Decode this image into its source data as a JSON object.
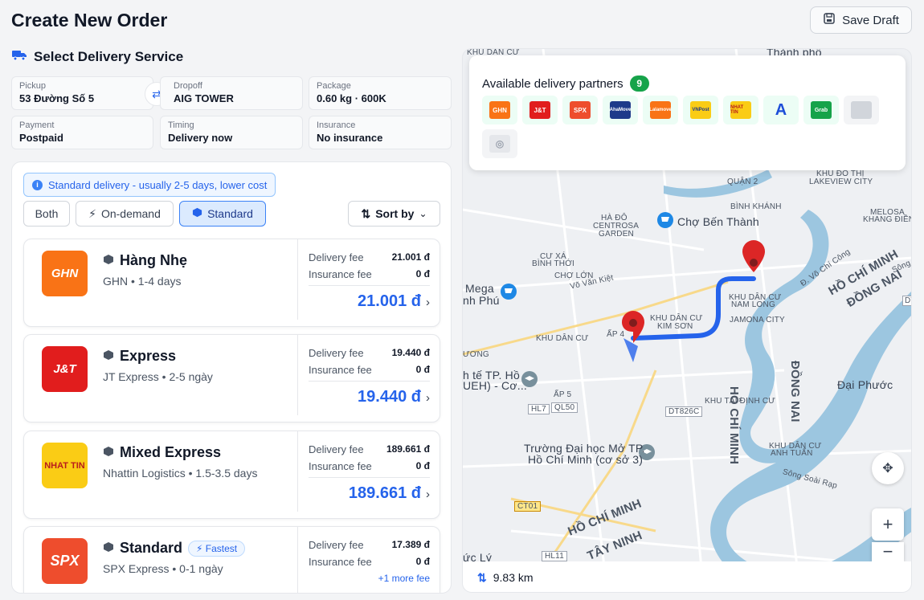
{
  "header": {
    "title": "Create New Order",
    "save_draft": "Save Draft"
  },
  "section": {
    "title": "Select Delivery Service"
  },
  "info": {
    "pickup": {
      "label": "Pickup",
      "value": "53 Đường Số 5"
    },
    "dropoff": {
      "label": "Dropoff",
      "value": "AIG TOWER"
    },
    "package": {
      "label": "Package",
      "value": "0.60 kg · 600K"
    },
    "payment": {
      "label": "Payment",
      "value": "Postpaid"
    },
    "timing": {
      "label": "Timing",
      "value": "Delivery now"
    },
    "insurance": {
      "label": "Insurance",
      "value": "No insurance"
    }
  },
  "notice": "Standard delivery - usually 2-5 days, lower cost",
  "filters": {
    "both": "Both",
    "on_demand": "On-demand",
    "standard": "Standard",
    "sort": "Sort by"
  },
  "services": [
    {
      "name": "Hàng Nhẹ",
      "carrier": "GHN • 1-4 days",
      "logo_text": "GHN",
      "logo_bg": "#f97316",
      "logo_fg": "#ffffff",
      "delivery_fee_label": "Delivery fee",
      "delivery_fee": "21.001 đ",
      "insurance_fee_label": "Insurance fee",
      "insurance_fee": "0 đ",
      "total": "21.001 đ"
    },
    {
      "name": "Express",
      "carrier": "JT Express • 2-5 ngày",
      "logo_text": "J&T",
      "logo_bg": "#e11d1d",
      "logo_fg": "#ffffff",
      "delivery_fee_label": "Delivery fee",
      "delivery_fee": "19.440 đ",
      "insurance_fee_label": "Insurance fee",
      "insurance_fee": "0 đ",
      "total": "19.440 đ"
    },
    {
      "name": "Mixed Express",
      "carrier": "Nhattin Logistics • 1.5-3.5 days",
      "logo_text": "NHAT TIN",
      "logo_bg": "#facc15",
      "logo_fg": "#b91c1c",
      "delivery_fee_label": "Delivery fee",
      "delivery_fee": "189.661 đ",
      "insurance_fee_label": "Insurance fee",
      "insurance_fee": "0 đ",
      "total": "189.661 đ"
    },
    {
      "name": "Standard",
      "badge": "Fastest",
      "carrier": "SPX Express • 0-1 ngày",
      "logo_text": "SPX",
      "logo_bg": "#ee4d2d",
      "logo_fg": "#ffffff",
      "delivery_fee_label": "Delivery fee",
      "delivery_fee": "17.389 đ",
      "insurance_fee_label": "Insurance fee",
      "insurance_fee": "0 đ",
      "more_fee": "+1 more fee"
    }
  ],
  "partners": {
    "title": "Available delivery partners",
    "count": "9",
    "logos": [
      {
        "name": "GHN",
        "color": "#f97316"
      },
      {
        "name": "J&T",
        "color": "#e11d1d"
      },
      {
        "name": "SPX",
        "color": "#ee4d2d"
      },
      {
        "name": "AhaMove",
        "color": "#1e3a8a"
      },
      {
        "name": "Lalamove",
        "color": "#f97316"
      },
      {
        "name": "VNPost",
        "color": "#facc15"
      },
      {
        "name": "NHAT TIN",
        "color": "#facc15"
      },
      {
        "name": "A",
        "color": "#1d4ed8"
      },
      {
        "name": "Grab",
        "color": "#16a34a"
      },
      {
        "name": "",
        "color": "#d1d5db"
      },
      {
        "name": "",
        "color": "#e5e7eb"
      }
    ]
  },
  "map": {
    "distance": "9.83 km",
    "labels": {
      "khu_dan_cu_top": "KHU DÂN CƯ",
      "thanh_pho": "Thành phố",
      "quan2": "QUẬN 2",
      "khu_do_thi": "KHU ĐÔ THỊ",
      "lakeview": "LAKEVIEW CITY",
      "binh_khanh": "BÌNH KHÁNH",
      "ha_do": "HÀ ĐÔ",
      "centrosa": "CENTROSA",
      "garden": "GARDEN",
      "cho_ben_thanh": "Chợ Bến Thành",
      "melosa": "MELOSA",
      "khang_dien": "KHANG ĐIỀN",
      "cu_xa": "CƯ XÁ",
      "binh_thoi": "BÌNH THỚI",
      "cho_lon": "CHỢ LỚN",
      "vo_van_kiet": "Võ Văn Kiệt",
      "vo_chi_cong": "Đ. Võ Chí Công",
      "ho_chi_minh_1": "HỒ CHÍ MINH",
      "dong_nai_1": "ĐỒNG NAI",
      "song_sai": "Sông Sài",
      "mega": "Mega",
      "nh_phu": "nh Phú",
      "khu_dan_cu_nl": "KHU DÂN CƯ",
      "nam_long": "NAM LONG",
      "jamona": "JAMONA CITY",
      "khu_dan_cu_ks": "KHU DÂN CƯ",
      "kim_son": "KIM SƠN",
      "khu_dan_cu_2": "KHU DÂN CƯ",
      "ap4": "ẤP 4",
      "uong": "ƯƠNG",
      "te_tp": "h tế TP. Hồ",
      "ueh": "UEH) - Cơ...",
      "ap5": "ẤP 5",
      "hl7": "HL7",
      "ql50": "QL50",
      "dt826c": "DT826C",
      "khu_tai_dinh_cu": "KHU TÁI ĐỊNH CƯ",
      "dai_phuoc": "Đại Phước",
      "ho_chi_minh_v": "HỒ CHÍ MINH",
      "dong_nai_v": "ĐỒNG NAI",
      "truong_dh": "Trường Đại học Mở TP.",
      "truong_dh2": "Hồ Chí Minh (cơ sở 3)",
      "khu_dan_cu_at": "KHU DÂN CƯ",
      "anh_tuan": "ANH TUẤN",
      "song_soai_rap": "Sông Soài Rạp",
      "ct01": "CT01",
      "ho_chi_minh_2": "HỒ CHÍ MINH",
      "tay_ninh": "TÂY NINH",
      "uc_ly": "ức Lý",
      "hl11": "HL11",
      "dt": "DT"
    }
  },
  "colors": {
    "accent": "#2563eb",
    "route": "#2563eb",
    "pin": "#dc2626",
    "water": "#9cc6e0"
  }
}
